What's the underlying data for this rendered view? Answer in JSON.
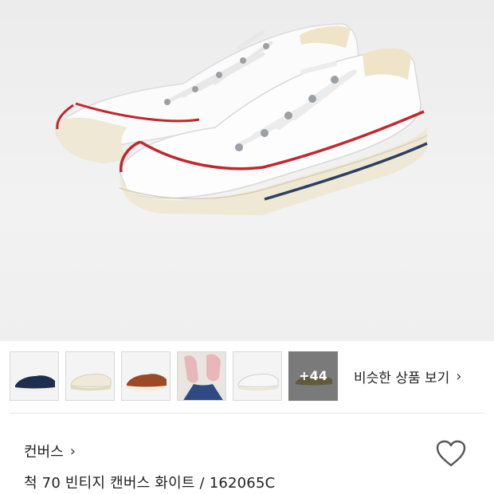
{
  "product": {
    "images": {
      "main": "white-low-top-canvas-sneakers-pair",
      "thumbnails": [
        {
          "name": "navy-sneaker-thumbnail",
          "color": "#1f2d4f"
        },
        {
          "name": "cream-sneaker-thumbnail",
          "color": "#efe9d8"
        },
        {
          "name": "brown-sneaker-thumbnail",
          "color": "#9b4a26"
        },
        {
          "name": "pink-sneaker-worn-thumbnail",
          "color": "#e9b7b9"
        },
        {
          "name": "white-sneaker-thumbnail",
          "color": "#f3f3f3"
        }
      ],
      "more_count_label": "+44"
    },
    "similar_link_label": "비슷한 상품 보기",
    "brand": "컨버스",
    "name": "척 70 빈티지 캔버스 화이트 / 162065C"
  },
  "icons": {
    "chevron_right": "›",
    "wishlist": "heart-outline-icon"
  }
}
